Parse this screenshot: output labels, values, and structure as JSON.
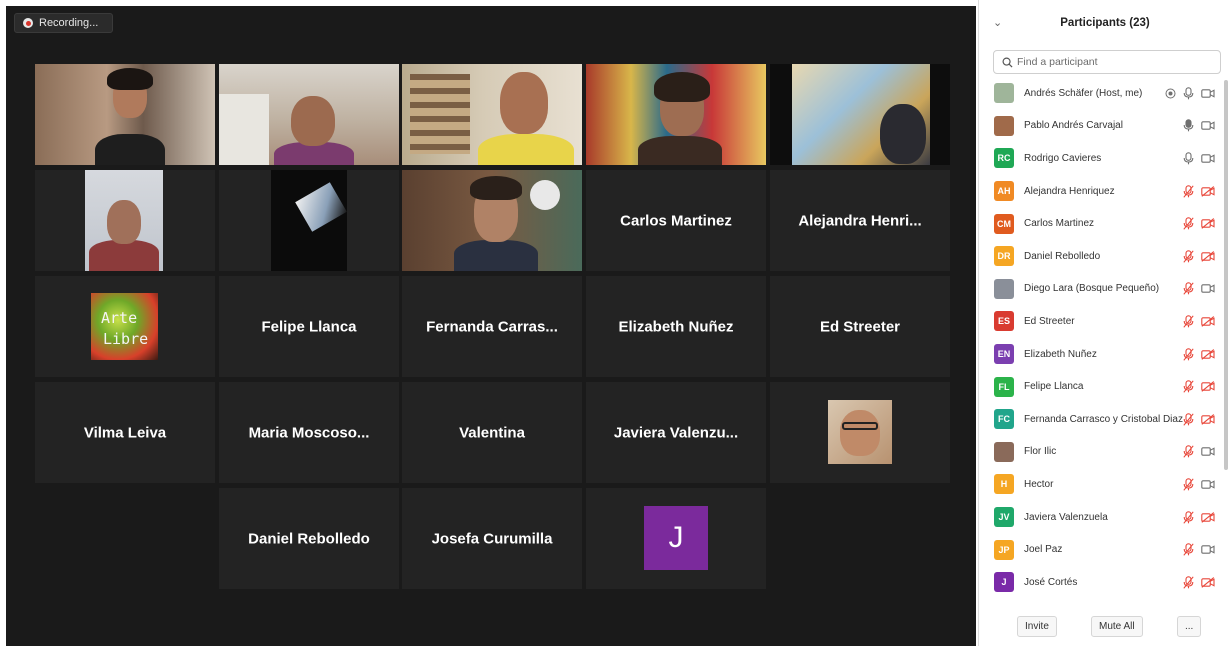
{
  "recording": {
    "label": "Recording..."
  },
  "gallery": {
    "tiles": [
      {
        "name": ""
      },
      {
        "name": ""
      },
      {
        "name": ""
      },
      {
        "name": ""
      },
      {
        "name": ""
      },
      {
        "name": ""
      },
      {
        "name": ""
      },
      {
        "name": ""
      },
      {
        "name": "Carlos Martinez"
      },
      {
        "name": "Alejandra  Henri..."
      },
      {
        "name": ""
      },
      {
        "name": "Felipe Llanca"
      },
      {
        "name": "Fernanda  Carras..."
      },
      {
        "name": "Elizabeth Nuñez"
      },
      {
        "name": "Ed Streeter"
      },
      {
        "name": "Vilma Leiva"
      },
      {
        "name": "Maria  Moscoso..."
      },
      {
        "name": "Valentina"
      },
      {
        "name": "Javiera  Valenzu..."
      },
      {
        "name": ""
      },
      {
        "name": "Daniel Rebolledo"
      },
      {
        "name": "Josefa Curumilla"
      },
      {
        "avatar_letter": "J"
      }
    ],
    "arte_libre_logo": {
      "line1": "Arte",
      "line2": "Libre"
    }
  },
  "participants_panel": {
    "title": "Participants (23)",
    "search": {
      "placeholder": "Find a participant",
      "value": ""
    },
    "participants": [
      {
        "initials": "",
        "name": "Andrés Schäfer (Host, me)",
        "avatar_color": "#9fb59a",
        "mic": "on",
        "video": "off",
        "record": true
      },
      {
        "initials": "",
        "name": "Pablo Andrés Carvajal",
        "avatar_color": "#a06a4a",
        "mic": "speaking",
        "video": "off"
      },
      {
        "initials": "RC",
        "name": "Rodrigo Cavieres",
        "avatar_color": "#1fa855",
        "mic": "on",
        "video": "off"
      },
      {
        "initials": "AH",
        "name": "Alejandra Henriquez",
        "avatar_color": "#f08a24",
        "mic": "muted",
        "video": "muted"
      },
      {
        "initials": "CM",
        "name": "Carlos Martinez",
        "avatar_color": "#e05b1f",
        "mic": "muted",
        "video": "muted"
      },
      {
        "initials": "DR",
        "name": "Daniel Rebolledo",
        "avatar_color": "#f5a623",
        "mic": "muted",
        "video": "muted"
      },
      {
        "initials": "",
        "name": "Diego Lara (Bosque Pequeño)",
        "avatar_color": "#8a8f99",
        "mic": "muted",
        "video": "off"
      },
      {
        "initials": "ES",
        "name": "Ed Streeter",
        "avatar_color": "#d93b30",
        "mic": "muted",
        "video": "muted"
      },
      {
        "initials": "EN",
        "name": "Elizabeth Nuñez",
        "avatar_color": "#7b3fb0",
        "mic": "muted",
        "video": "muted"
      },
      {
        "initials": "FL",
        "name": "Felipe Llanca",
        "avatar_color": "#2bb34a",
        "mic": "muted",
        "video": "muted"
      },
      {
        "initials": "FC",
        "name": "Fernanda Carrasco y Cristobal Diaz",
        "avatar_color": "#21a58b",
        "mic": "muted",
        "video": "muted"
      },
      {
        "initials": "",
        "name": "Flor Ilic",
        "avatar_color": "#8a6a5a",
        "mic": "muted",
        "video": "off"
      },
      {
        "initials": "H",
        "name": "Hector",
        "avatar_color": "#f5a623",
        "mic": "muted",
        "video": "off"
      },
      {
        "initials": "JV",
        "name": "Javiera Valenzuela",
        "avatar_color": "#1fa86a",
        "mic": "muted",
        "video": "muted"
      },
      {
        "initials": "JP",
        "name": "Joel Paz",
        "avatar_color": "#f5a623",
        "mic": "muted",
        "video": "off"
      },
      {
        "initials": "J",
        "name": "José Cortés",
        "avatar_color": "#7a2aa8",
        "mic": "muted",
        "video": "muted"
      }
    ],
    "footer": {
      "invite": "Invite",
      "mute_all": "Mute All",
      "more": "..."
    }
  },
  "colors": {
    "muted_red": "#e8473a",
    "icon_gray": "#6f6f6f",
    "active_speaker": "#c9e36b"
  }
}
